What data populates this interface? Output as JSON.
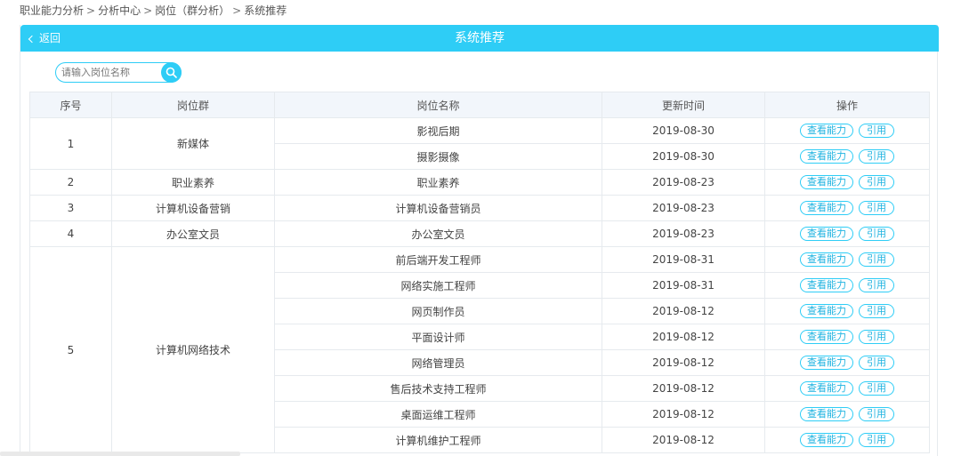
{
  "breadcrumb": [
    "职业能力分析",
    "分析中心",
    "岗位（群分析）",
    "系统推荐"
  ],
  "breadcrumb_sep": ">",
  "header": {
    "back_label": "返回",
    "title": "系统推荐"
  },
  "search": {
    "placeholder": "请输入岗位名称",
    "value": ""
  },
  "colors": {
    "accent": "#2ecdf6",
    "header_bg": "#f2f6fb"
  },
  "icons": {
    "search": "search-icon",
    "back": "chevron-left-icon"
  },
  "table": {
    "columns": [
      "序号",
      "岗位群",
      "岗位名称",
      "更新时间",
      "操作"
    ],
    "action_view": "查看能力",
    "action_cite": "引用",
    "groups": [
      {
        "no": "1",
        "group": "新媒体",
        "jobs": [
          {
            "name": "影视后期",
            "date": "2019-08-30"
          },
          {
            "name": "摄影摄像",
            "date": "2019-08-30"
          }
        ]
      },
      {
        "no": "2",
        "group": "职业素养",
        "jobs": [
          {
            "name": "职业素养",
            "date": "2019-08-23"
          }
        ]
      },
      {
        "no": "3",
        "group": "计算机设备营销",
        "jobs": [
          {
            "name": "计算机设备营销员",
            "date": "2019-08-23"
          }
        ]
      },
      {
        "no": "4",
        "group": "办公室文员",
        "jobs": [
          {
            "name": "办公室文员",
            "date": "2019-08-23"
          }
        ]
      },
      {
        "no": "5",
        "group": "计算机网络技术",
        "jobs": [
          {
            "name": "前后端开发工程师",
            "date": "2019-08-31"
          },
          {
            "name": "网络实施工程师",
            "date": "2019-08-31"
          },
          {
            "name": "网页制作员",
            "date": "2019-08-12"
          },
          {
            "name": "平面设计师",
            "date": "2019-08-12"
          },
          {
            "name": "网络管理员",
            "date": "2019-08-12"
          },
          {
            "name": "售后技术支持工程师",
            "date": "2019-08-12"
          },
          {
            "name": "桌面运维工程师",
            "date": "2019-08-12"
          },
          {
            "name": "计算机维护工程师",
            "date": "2019-08-12"
          }
        ]
      }
    ]
  }
}
